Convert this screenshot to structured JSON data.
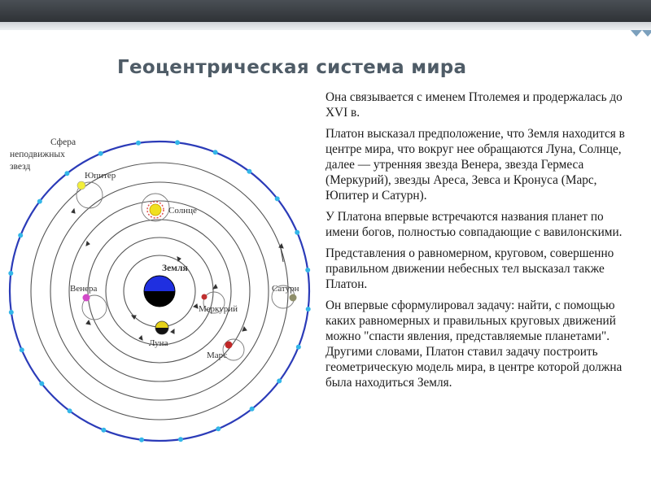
{
  "slide": {
    "title": "Геоцентрическая система мира",
    "paragraphs": [
      "Она связывается с именем Птолемея и продержалась до XVI в.",
      " Платон высказал предположение, что Земля находится в центре мира, что вокруг нее обращаются Луна, Солнце, далее — утренняя звезда Венера, звезда Гермеса (Меркурий), звезды Ареса, Зевса и Кронуса (Марс, Юпитер и Сатурн).",
      " У Платона впервые встречаются названия планет по имени богов, полностью совпадающие с вавилонскими.",
      " Представления о равномерном, круговом, совершенно правильном движении небесных тел высказал также Платон.",
      " Он впервые сформулировал задачу: найти, с помощью каких равномерных и правильных круговых движений можно \"спасти явления, представляемые планетами\". Другими словами, Платон ставил задачу построить геометрическую модель мира, в центре которой должна была находиться Земля."
    ]
  },
  "diagram": {
    "labels": {
      "sphere": [
        "Сфера",
        "неподвижных",
        "звезд"
      ],
      "jupiter": "Юпитер",
      "sun": "Солнце",
      "earth": "Земля",
      "venus": "Венера",
      "mercury": "Меркурий",
      "saturn": "Сатурн",
      "moon": "Луна",
      "mars": "Марс"
    },
    "colors": {
      "outer_circle": "#2b3bb8",
      "star": "#33b6e8",
      "earth_top": "#1f2fe0",
      "earth_bottom": "#000000",
      "sun": "#f0e020",
      "sun_rays": "#e05050",
      "jupiter": "#f2ee3a",
      "moon": "#e6d21a",
      "venus": "#d24ac8",
      "mercury": "#c03030",
      "mars": "#c02828",
      "saturn": "#8e8e6a",
      "orbit": "#555555"
    }
  }
}
